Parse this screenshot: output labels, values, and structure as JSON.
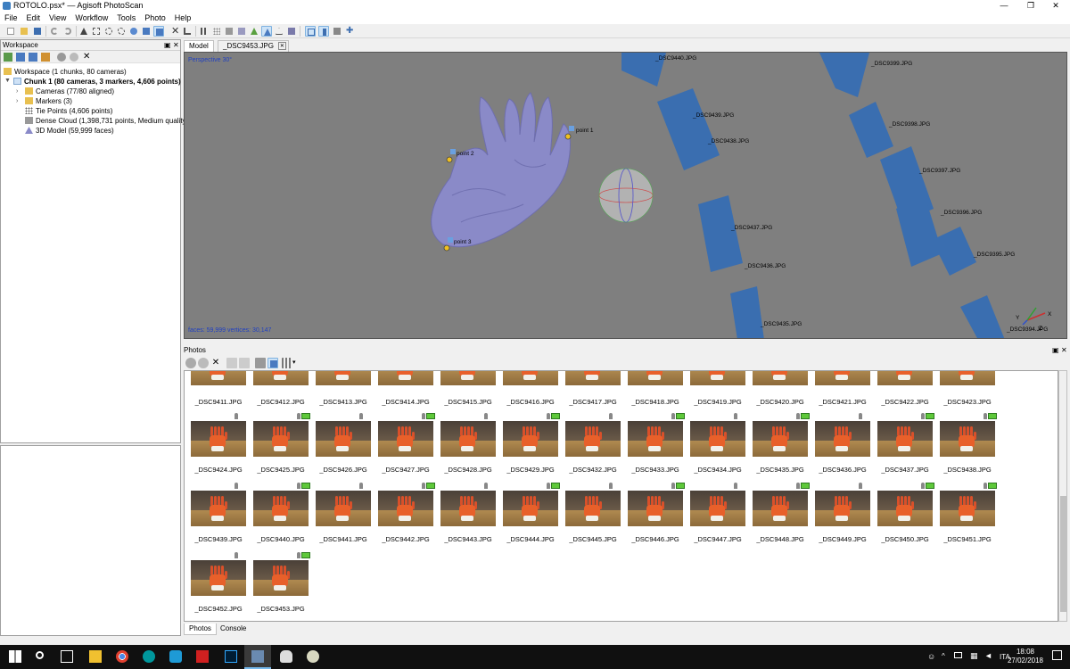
{
  "window": {
    "title": "ROTOLO.psx* — Agisoft PhotoScan",
    "minimize": "—",
    "restore": "❐",
    "close": "✕"
  },
  "menu": [
    "File",
    "Edit",
    "View",
    "Workflow",
    "Tools",
    "Photo",
    "Help"
  ],
  "workspace": {
    "header": "Workspace",
    "root": "Workspace (1 chunks, 80 cameras)",
    "chunk": "Chunk 1 (80 cameras, 3 markers, 4,606 points)",
    "items": [
      {
        "label": "Cameras (77/80 aligned)",
        "icon": "folder-icon"
      },
      {
        "label": "Markers (3)",
        "icon": "folder-icon"
      },
      {
        "label": "Tie Points (4,606 points)",
        "icon": "points-icon"
      },
      {
        "label": "Dense Cloud (1,398,731 points, Medium quality)",
        "icon": "dense-cloud-icon"
      },
      {
        "label": "3D Model (59,999 faces)",
        "icon": "mesh-icon"
      }
    ]
  },
  "view_tabs": [
    {
      "label": "Model",
      "active": true
    },
    {
      "label": "_DSC9453.JPG",
      "active": false
    }
  ],
  "model_view": {
    "projection": "Perspective 30°",
    "stats": "faces: 59,999 vertices: 30,147",
    "markers": [
      "point 1",
      "point 2",
      "point 3"
    ],
    "cameras": [
      "_DSC9440.JPG",
      "_DSC9439.JPG",
      "_DSC9438.JPG",
      "_DSC9437.JPG",
      "_DSC9436.JPG",
      "_DSC9435.JPG",
      "_DSC9399.JPG",
      "_DSC9398.JPG",
      "_DSC9397.JPG",
      "_DSC9396.JPG",
      "_DSC9395.JPG",
      "_DSC9394.JPG"
    ],
    "axes": [
      "X",
      "Y",
      "Z"
    ],
    "camera_color": "#3a6eb0",
    "mesh_color": "#8a8ac8"
  },
  "photos": {
    "header": "Photos",
    "row0": [
      "_DSC9411.JPG",
      "_DSC9412.JPG",
      "_DSC9413.JPG",
      "_DSC9414.JPG",
      "_DSC9415.JPG",
      "_DSC9416.JPG",
      "_DSC9417.JPG",
      "_DSC9418.JPG",
      "_DSC9419.JPG",
      "_DSC9420.JPG",
      "_DSC9421.JPG",
      "_DSC9422.JPG",
      "_DSC9423.JPG"
    ],
    "row1": [
      "_DSC9424.JPG",
      "_DSC9425.JPG",
      "_DSC9426.JPG",
      "_DSC9427.JPG",
      "_DSC9428.JPG",
      "_DSC9429.JPG",
      "_DSC9432.JPG",
      "_DSC9433.JPG",
      "_DSC9434.JPG",
      "_DSC9435.JPG",
      "_DSC9436.JPG",
      "_DSC9437.JPG",
      "_DSC9438.JPG"
    ],
    "row2": [
      "_DSC9439.JPG",
      "_DSC9440.JPG",
      "_DSC9441.JPG",
      "_DSC9442.JPG",
      "_DSC9443.JPG",
      "_DSC9444.JPG",
      "_DSC9445.JPG",
      "_DSC9446.JPG",
      "_DSC9447.JPG",
      "_DSC9448.JPG",
      "_DSC9449.JPG",
      "_DSC9450.JPG",
      "_DSC9451.JPG"
    ],
    "row3": [
      "_DSC9452.JPG",
      "_DSC9453.JPG"
    ]
  },
  "bottom_tabs": [
    "Photos",
    "Console"
  ],
  "taskbar": {
    "lang": "ITA",
    "time": "18:08",
    "date": "27/02/2018"
  }
}
